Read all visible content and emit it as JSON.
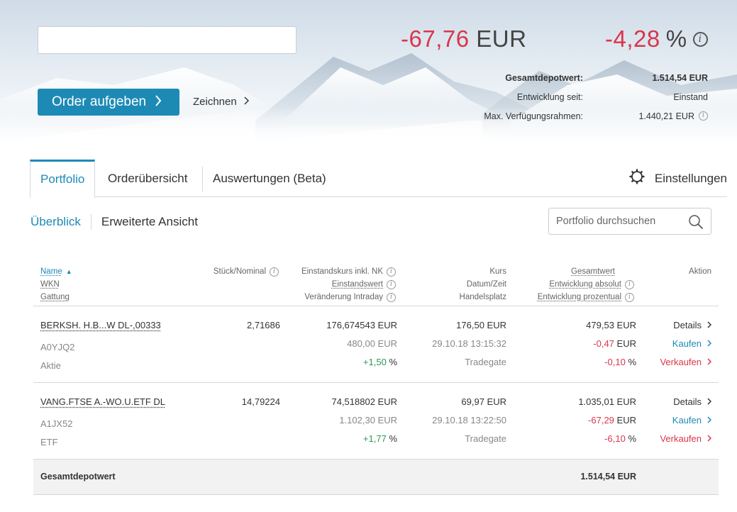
{
  "header": {
    "search_value": "",
    "order_button_label": "Order aufgeben",
    "zeichnen_label": "Zeichnen",
    "change_abs_value": "-67,76",
    "change_abs_unit": "EUR",
    "change_pct_value": "-4,28",
    "change_pct_unit": "%",
    "summary": [
      {
        "label": "Gesamtdepotwert:",
        "value": "1.514,54 EUR"
      },
      {
        "label": "Entwicklung seit:",
        "value": "Einstand"
      },
      {
        "label": "Max. Verfügungsrahmen:",
        "value": "1.440,21 EUR"
      }
    ]
  },
  "tabs": {
    "portfolio": "Portfolio",
    "orders": "Orderübersicht",
    "analysis": "Auswertungen (Beta)",
    "settings": "Einstellungen"
  },
  "subnav": {
    "overview": "Überblick",
    "extended": "Erweiterte Ansicht",
    "search_placeholder": "Portfolio durchsuchen"
  },
  "columns": {
    "name": "Name",
    "wkn": "WKN",
    "gattung": "Gattung",
    "stueck": "Stück/Nominal",
    "einstandskurs": "Einstandskurs inkl. NK",
    "einstandswert": "Einstandswert",
    "veraenderung": "Veränderung Intraday",
    "kurs": "Kurs",
    "datum": "Datum/Zeit",
    "handelsplatz": "Handelsplatz",
    "gesamtwert": "Gesamtwert",
    "entw_abs": "Entwicklung absolut",
    "entw_pct": "Entwicklung prozentual",
    "aktion": "Aktion"
  },
  "rows": [
    {
      "name": "BERKSH. H.B...W DL-,00333",
      "wkn": "A0YJQ2",
      "gattung": "Aktie",
      "stueck": "2,71686",
      "einstandskurs": "176,674543 EUR",
      "einstandswert": "480,00 EUR",
      "intraday_value": "+1,50",
      "intraday_unit": "%",
      "kurs": "176,50 EUR",
      "datum": "29.10.18 13:15:32",
      "handelsplatz": "Tradegate",
      "gesamtwert": "479,53 EUR",
      "entw_abs_value": "-0,47",
      "entw_abs_unit": "EUR",
      "entw_pct_value": "-0,10",
      "entw_pct_unit": "%",
      "details": "Details",
      "kaufen": "Kaufen",
      "verkaufen": "Verkaufen"
    },
    {
      "name": "VANG.FTSE A.-WO.U.ETF DL",
      "wkn": "A1JX52",
      "gattung": "ETF",
      "stueck": "14,79224",
      "einstandskurs": "74,518802 EUR",
      "einstandswert": "1.102,30 EUR",
      "intraday_value": "+1,77",
      "intraday_unit": "%",
      "kurs": "69,97 EUR",
      "datum": "29.10.18 13:22:50",
      "handelsplatz": "Tradegate",
      "gesamtwert": "1.035,01 EUR",
      "entw_abs_value": "-67,29",
      "entw_abs_unit": "EUR",
      "entw_pct_value": "-6,10",
      "entw_pct_unit": "%",
      "details": "Details",
      "kaufen": "Kaufen",
      "verkaufen": "Verkaufen"
    }
  ],
  "total": {
    "label": "Gesamtdepotwert",
    "value": "1.514,54 EUR"
  },
  "colors": {
    "accent": "#1d8ab5",
    "negative": "#d9364a",
    "positive": "#2b9a55"
  },
  "icons": [
    "info-icon",
    "chevron-right-icon",
    "gear-icon",
    "search-icon",
    "sort-asc-icon"
  ]
}
